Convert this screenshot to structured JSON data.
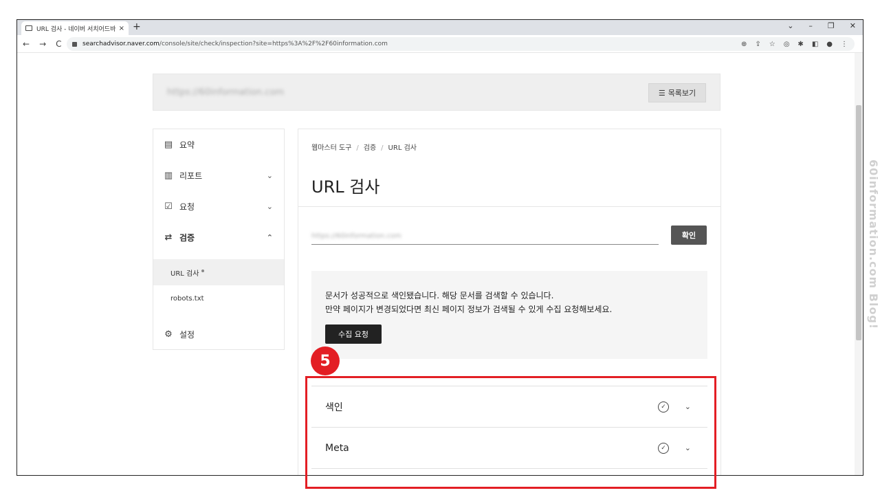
{
  "browser": {
    "tab_title": "URL 검사 - 네이버 서치어드바이",
    "tab_close": "×",
    "new_tab": "+",
    "window_controls": [
      "⌄",
      "–",
      "❐",
      "✕"
    ],
    "nav": [
      "←",
      "→",
      "C"
    ],
    "url_host": "searchadvisor.naver.com",
    "url_path": "/console/site/check/inspection?site=https%3A%2F%2F60information.com",
    "toolbar_icons": [
      "zoom-icon",
      "share-icon",
      "star-icon",
      "camera-icon",
      "extensions-icon",
      "sidepanel-icon",
      "profile-icon",
      "menu-icon"
    ]
  },
  "header": {
    "site": "https://60information.com",
    "list_button": "목록보기",
    "list_icon": "☰"
  },
  "sidebar": {
    "items": [
      {
        "label": "요약",
        "icon": "clipboard-icon"
      },
      {
        "label": "리포트",
        "icon": "chart-icon",
        "chevron": "⌄"
      },
      {
        "label": "요청",
        "icon": "checklist-icon",
        "chevron": "⌄"
      },
      {
        "label": "검증",
        "icon": "swap-icon",
        "chevron": "⌃"
      },
      {
        "label": "설정",
        "icon": "gear-icon"
      }
    ],
    "sub_items": [
      "URL 검사",
      "robots.txt"
    ]
  },
  "main": {
    "breadcrumb": [
      "웹마스터 도구",
      "검증",
      "URL 검사"
    ],
    "breadcrumb_sep": "/",
    "title": "URL 검사",
    "url_value": "https://60information.com",
    "confirm_button": "확인",
    "message_line1": "문서가 성공적으로 색인됐습니다. 해당 문서를 검색할 수 있습니다.",
    "message_line2": "만약 페이지가 변경되었다면 최신 페이지 정보가 검색될 수 있게 수집 요청해보세요.",
    "collect_button": "수집 요청",
    "sections": [
      {
        "label": "색인",
        "status": "✓",
        "chevron": "⌄"
      },
      {
        "label": "Meta",
        "status": "✓",
        "chevron": "⌄"
      }
    ]
  },
  "annotation": {
    "step": "5",
    "color": "#e31e24"
  },
  "watermark": "60information.com Blog!"
}
